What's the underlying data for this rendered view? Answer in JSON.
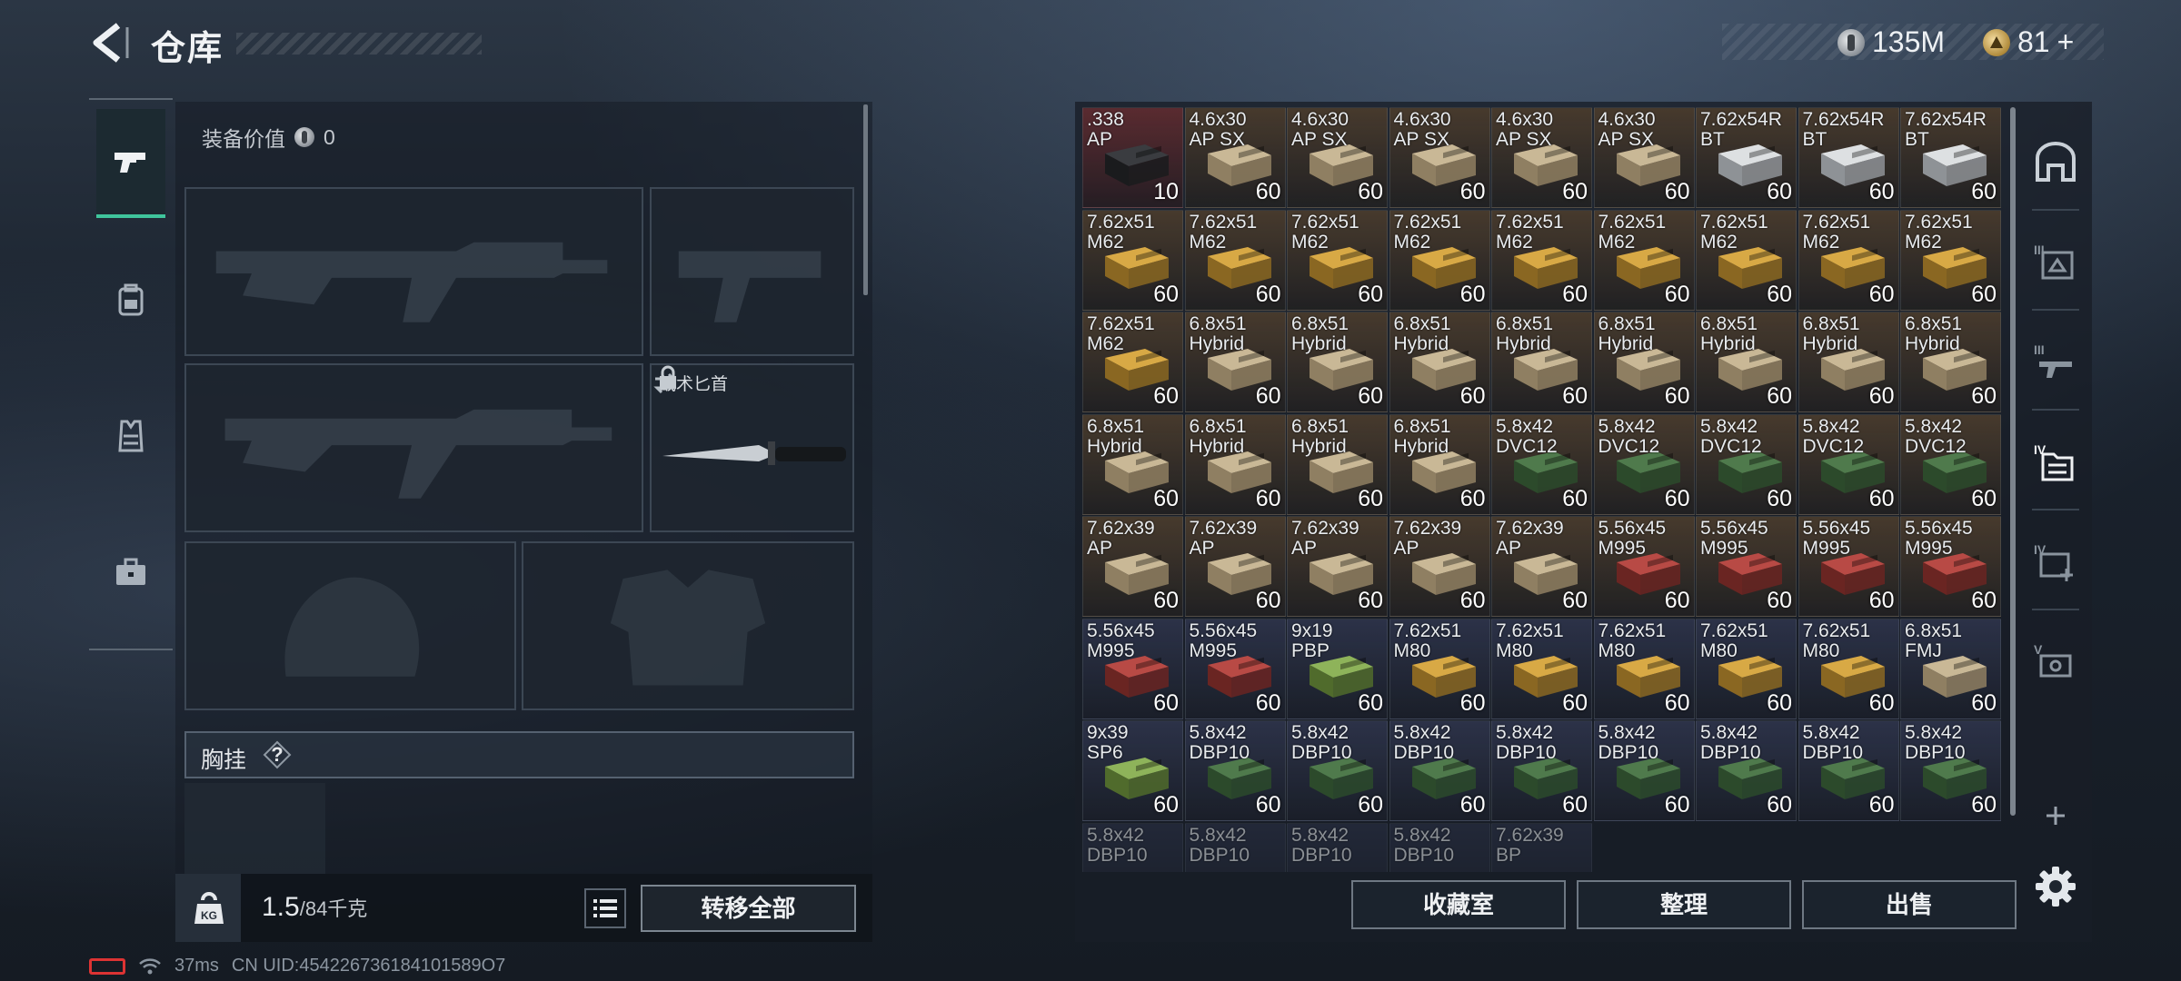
{
  "header": {
    "title": "仓库",
    "currency_silver": "135M",
    "currency_gold": "81",
    "add_symbol": "+"
  },
  "loadout": {
    "equip_value_label": "装备价值",
    "equip_value": "0",
    "knife_label": "战术匕首",
    "rig_label": "胸挂",
    "rig_help": "?"
  },
  "weight": {
    "current": "1.5",
    "max": "/84千克",
    "kg_icon_text": "KG"
  },
  "buttons": {
    "transfer_all": "转移全部",
    "collection": "收藏室",
    "sort": "整理",
    "sell": "出售"
  },
  "status": {
    "ping": "37ms",
    "uid": "CN UID:454226736184101589O7"
  },
  "colors": {
    "accent_green": "#3fc59c",
    "bg_red": "#5a2b30",
    "bg_brown": "#4a3b2e",
    "bg_blue": "#2b3148"
  },
  "inventory": [
    {
      "label": ".338\nAP",
      "count": "10",
      "box": "dark",
      "bg": "red"
    },
    {
      "label": "4.6x30\nAP SX",
      "count": "60",
      "box": "tan",
      "bg": "brown"
    },
    {
      "label": "4.6x30\nAP SX",
      "count": "60",
      "box": "tan",
      "bg": "brown"
    },
    {
      "label": "4.6x30\nAP SX",
      "count": "60",
      "box": "tan",
      "bg": "brown"
    },
    {
      "label": "4.6x30\nAP SX",
      "count": "60",
      "box": "tan",
      "bg": "brown"
    },
    {
      "label": "4.6x30\nAP SX",
      "count": "60",
      "box": "tan",
      "bg": "brown"
    },
    {
      "label": "7.62x54R\nBT",
      "count": "60",
      "box": "white",
      "bg": "brown"
    },
    {
      "label": "7.62x54R\nBT",
      "count": "60",
      "box": "white",
      "bg": "brown"
    },
    {
      "label": "7.62x54R\nBT",
      "count": "60",
      "box": "white",
      "bg": "brown"
    },
    {
      "label": "7.62x51\nM62",
      "count": "60",
      "box": "yellow",
      "bg": "brown"
    },
    {
      "label": "7.62x51\nM62",
      "count": "60",
      "box": "yellow",
      "bg": "brown"
    },
    {
      "label": "7.62x51\nM62",
      "count": "60",
      "box": "yellow",
      "bg": "brown"
    },
    {
      "label": "7.62x51\nM62",
      "count": "60",
      "box": "yellow",
      "bg": "brown"
    },
    {
      "label": "7.62x51\nM62",
      "count": "60",
      "box": "yellow",
      "bg": "brown"
    },
    {
      "label": "7.62x51\nM62",
      "count": "60",
      "box": "yellow",
      "bg": "brown"
    },
    {
      "label": "7.62x51\nM62",
      "count": "60",
      "box": "yellow",
      "bg": "brown"
    },
    {
      "label": "7.62x51\nM62",
      "count": "60",
      "box": "yellow",
      "bg": "brown"
    },
    {
      "label": "7.62x51\nM62",
      "count": "60",
      "box": "yellow",
      "bg": "brown"
    },
    {
      "label": "7.62x51\nM62",
      "count": "60",
      "box": "yellow",
      "bg": "brown"
    },
    {
      "label": "6.8x51\nHybrid",
      "count": "60",
      "box": "tan",
      "bg": "brown"
    },
    {
      "label": "6.8x51\nHybrid",
      "count": "60",
      "box": "tan",
      "bg": "brown"
    },
    {
      "label": "6.8x51\nHybrid",
      "count": "60",
      "box": "tan",
      "bg": "brown"
    },
    {
      "label": "6.8x51\nHybrid",
      "count": "60",
      "box": "tan",
      "bg": "brown"
    },
    {
      "label": "6.8x51\nHybrid",
      "count": "60",
      "box": "tan",
      "bg": "brown"
    },
    {
      "label": "6.8x51\nHybrid",
      "count": "60",
      "box": "tan",
      "bg": "brown"
    },
    {
      "label": "6.8x51\nHybrid",
      "count": "60",
      "box": "tan",
      "bg": "brown"
    },
    {
      "label": "6.8x51\nHybrid",
      "count": "60",
      "box": "tan",
      "bg": "brown"
    },
    {
      "label": "6.8x51\nHybrid",
      "count": "60",
      "box": "tan",
      "bg": "brown"
    },
    {
      "label": "6.8x51\nHybrid",
      "count": "60",
      "box": "tan",
      "bg": "brown"
    },
    {
      "label": "6.8x51\nHybrid",
      "count": "60",
      "box": "tan",
      "bg": "brown"
    },
    {
      "label": "6.8x51\nHybrid",
      "count": "60",
      "box": "tan",
      "bg": "brown"
    },
    {
      "label": "5.8x42\nDVC12",
      "count": "60",
      "box": "green",
      "bg": "brown"
    },
    {
      "label": "5.8x42\nDVC12",
      "count": "60",
      "box": "green",
      "bg": "brown"
    },
    {
      "label": "5.8x42\nDVC12",
      "count": "60",
      "box": "green",
      "bg": "brown"
    },
    {
      "label": "5.8x42\nDVC12",
      "count": "60",
      "box": "green",
      "bg": "brown"
    },
    {
      "label": "5.8x42\nDVC12",
      "count": "60",
      "box": "green",
      "bg": "brown"
    },
    {
      "label": "7.62x39\nAP",
      "count": "60",
      "box": "tan",
      "bg": "brown"
    },
    {
      "label": "7.62x39\nAP",
      "count": "60",
      "box": "tan",
      "bg": "brown"
    },
    {
      "label": "7.62x39\nAP",
      "count": "60",
      "box": "tan",
      "bg": "brown"
    },
    {
      "label": "7.62x39\nAP",
      "count": "60",
      "box": "tan",
      "bg": "brown"
    },
    {
      "label": "7.62x39\nAP",
      "count": "60",
      "box": "tan",
      "bg": "brown"
    },
    {
      "label": "5.56x45\nM995",
      "count": "60",
      "box": "red",
      "bg": "brown"
    },
    {
      "label": "5.56x45\nM995",
      "count": "60",
      "box": "red",
      "bg": "brown"
    },
    {
      "label": "5.56x45\nM995",
      "count": "60",
      "box": "red",
      "bg": "brown"
    },
    {
      "label": "5.56x45\nM995",
      "count": "60",
      "box": "red",
      "bg": "brown"
    },
    {
      "label": "5.56x45\nM995",
      "count": "60",
      "box": "red",
      "bg": "blue"
    },
    {
      "label": "5.56x45\nM995",
      "count": "60",
      "box": "red",
      "bg": "blue"
    },
    {
      "label": "9x19\nPBP",
      "count": "60",
      "box": "lime",
      "bg": "blue"
    },
    {
      "label": "7.62x51\nM80",
      "count": "60",
      "box": "yellow",
      "bg": "blue"
    },
    {
      "label": "7.62x51\nM80",
      "count": "60",
      "box": "yellow",
      "bg": "blue"
    },
    {
      "label": "7.62x51\nM80",
      "count": "60",
      "box": "yellow",
      "bg": "blue"
    },
    {
      "label": "7.62x51\nM80",
      "count": "60",
      "box": "yellow",
      "bg": "blue"
    },
    {
      "label": "7.62x51\nM80",
      "count": "60",
      "box": "yellow",
      "bg": "blue"
    },
    {
      "label": "6.8x51\nFMJ",
      "count": "60",
      "box": "tan",
      "bg": "blue"
    },
    {
      "label": "9x39\nSP6",
      "count": "60",
      "box": "lime",
      "bg": "blue"
    },
    {
      "label": "5.8x42\nDBP10",
      "count": "60",
      "box": "green",
      "bg": "blue"
    },
    {
      "label": "5.8x42\nDBP10",
      "count": "60",
      "box": "green",
      "bg": "blue"
    },
    {
      "label": "5.8x42\nDBP10",
      "count": "60",
      "box": "green",
      "bg": "blue"
    },
    {
      "label": "5.8x42\nDBP10",
      "count": "60",
      "box": "green",
      "bg": "blue"
    },
    {
      "label": "5.8x42\nDBP10",
      "count": "60",
      "box": "green",
      "bg": "blue"
    },
    {
      "label": "5.8x42\nDBP10",
      "count": "60",
      "box": "green",
      "bg": "blue"
    },
    {
      "label": "5.8x42\nDBP10",
      "count": "60",
      "box": "green",
      "bg": "blue"
    },
    {
      "label": "5.8x42\nDBP10",
      "count": "60",
      "box": "green",
      "bg": "blue"
    },
    {
      "label": "5.8x42\nDBP10",
      "count": "",
      "box": "none",
      "bg": "blue",
      "faded": true
    },
    {
      "label": "5.8x42\nDBP10",
      "count": "",
      "box": "none",
      "bg": "blue",
      "faded": true
    },
    {
      "label": "5.8x42\nDBP10",
      "count": "",
      "box": "none",
      "bg": "blue",
      "faded": true
    },
    {
      "label": "5.8x42\nDBP10",
      "count": "",
      "box": "none",
      "bg": "blue",
      "faded": true
    },
    {
      "label": "7.62x39\nBP",
      "count": "",
      "box": "none",
      "bg": "blue",
      "faded": true
    }
  ]
}
